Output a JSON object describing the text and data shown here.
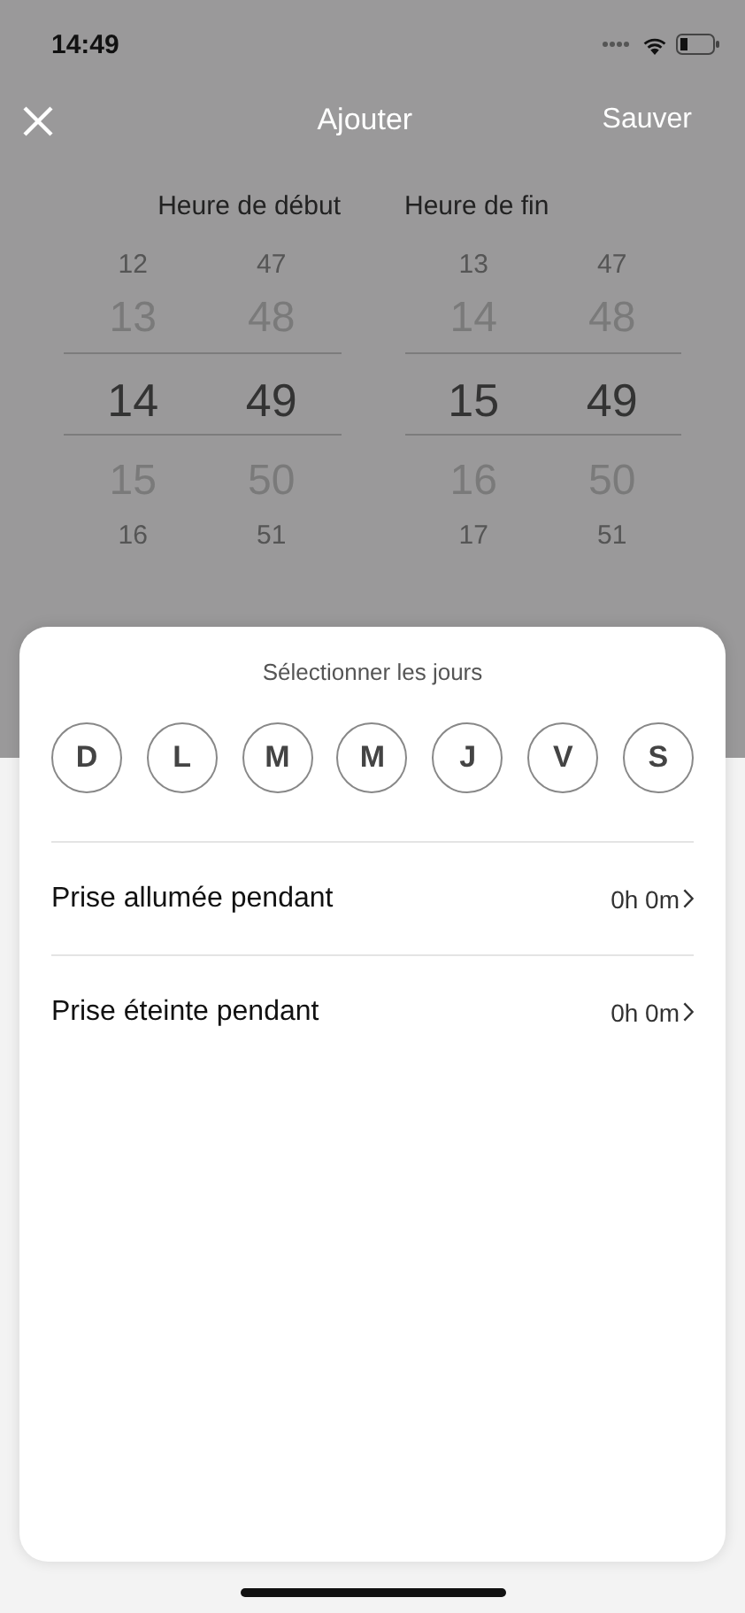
{
  "status_bar": {
    "time": "14:49"
  },
  "nav": {
    "title": "Ajouter",
    "action": "Sauver"
  },
  "pickers": [
    {
      "label": "Heure de début",
      "columns": [
        {
          "items": [
            {
              "text": "12",
              "selected": false
            },
            {
              "text": "13",
              "selected": false
            },
            {
              "text": "14",
              "selected": true
            },
            {
              "text": "15",
              "selected": false
            },
            {
              "text": "16",
              "selected": false
            }
          ]
        },
        {
          "items": [
            {
              "text": "47",
              "selected": false
            },
            {
              "text": "48",
              "selected": false
            },
            {
              "text": "49",
              "selected": true
            },
            {
              "text": "50",
              "selected": false
            },
            {
              "text": "51",
              "selected": false
            }
          ]
        }
      ]
    },
    {
      "label": "Heure de fin",
      "columns": [
        {
          "items": [
            {
              "text": "13",
              "selected": false
            },
            {
              "text": "14",
              "selected": false
            },
            {
              "text": "15",
              "selected": true
            },
            {
              "text": "16",
              "selected": false
            },
            {
              "text": "17",
              "selected": false
            }
          ]
        },
        {
          "items": [
            {
              "text": "47",
              "selected": false
            },
            {
              "text": "48",
              "selected": false
            },
            {
              "text": "49",
              "selected": true
            },
            {
              "text": "50",
              "selected": false
            },
            {
              "text": "51",
              "selected": false
            }
          ]
        }
      ]
    }
  ],
  "sheet": {
    "title": "Sélectionner les jours",
    "days": [
      {
        "label": "D",
        "selected": false
      },
      {
        "label": "L",
        "selected": false
      },
      {
        "label": "M",
        "selected": false
      },
      {
        "label": "M",
        "selected": false
      },
      {
        "label": "J",
        "selected": false
      },
      {
        "label": "V",
        "selected": false
      },
      {
        "label": "S",
        "selected": false
      }
    ],
    "rows": [
      {
        "label": "Prise allumée pendant",
        "value": "0h 0m"
      },
      {
        "label": "Prise éteinte pendant",
        "value": "0h 0m"
      }
    ]
  }
}
